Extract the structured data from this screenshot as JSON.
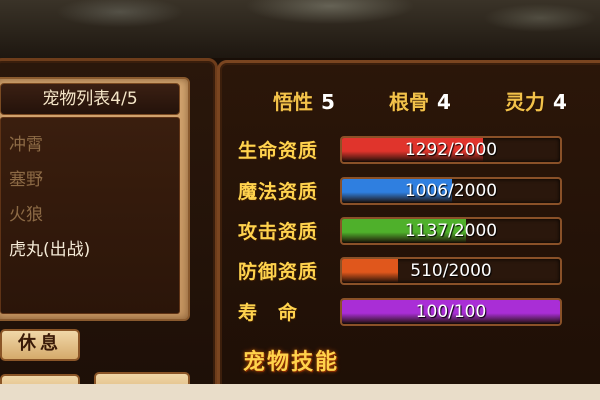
{
  "pet_list": {
    "title": "宠物列表4/5",
    "items": [
      {
        "label": "冲霄",
        "active": false
      },
      {
        "label": "塞野",
        "active": false
      },
      {
        "label": "火狼",
        "active": false
      },
      {
        "label": "虎丸(出战)",
        "active": true
      }
    ],
    "rest_button": "休息"
  },
  "attributes": [
    {
      "label": "悟性",
      "value": "5"
    },
    {
      "label": "根骨",
      "value": "4"
    },
    {
      "label": "灵力",
      "value": "4"
    }
  ],
  "stats": [
    {
      "label": "生命资质",
      "text": "1292/2000",
      "fraction": 0.646,
      "color": "#e0342c"
    },
    {
      "label": "魔法资质",
      "text": "1006/2000",
      "fraction": 0.503,
      "color": "#2f7fe0"
    },
    {
      "label": "攻击资质",
      "text": "1137/2000",
      "fraction": 0.5685,
      "color": "#4fb02b"
    },
    {
      "label": "防御资质",
      "text": "510/2000",
      "fraction": 0.255,
      "color": "#e0571c"
    },
    {
      "label": "寿　命",
      "text": "100/100",
      "fraction": 1.0,
      "color": "#a92ed6"
    }
  ],
  "skills_title": "宠物技能"
}
